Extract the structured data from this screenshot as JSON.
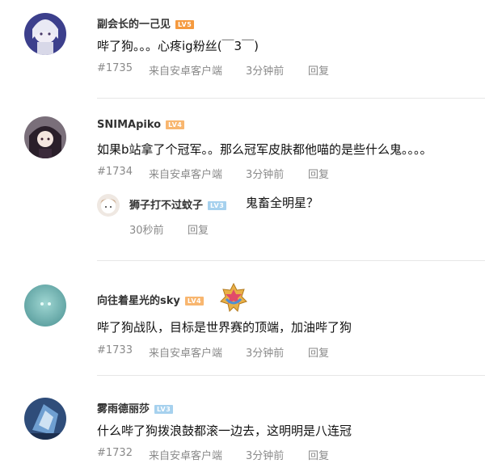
{
  "comments": [
    {
      "name": "副会长的一己见",
      "level": "LV5",
      "text": "哔了狗。。。心疼ig粉丝(￣3￣)",
      "floor": "#1735",
      "source": "来自安卓客户端",
      "time": "3分钟前",
      "reply": "回复"
    },
    {
      "name": "SNIMApiko",
      "level": "LV4",
      "text": "如果b站拿了个冠军。。那么冠军皮肤都他喵的是些什么鬼。。。。",
      "floor": "#1734",
      "source": "来自安卓客户端",
      "time": "3分钟前",
      "reply": "回复",
      "sub_reply": {
        "name": "狮子打不过蚊子",
        "level": "LV3",
        "text": "鬼畜全明星？",
        "time": "30秒前",
        "reply": "回复"
      }
    },
    {
      "name": "向往着星光的sky",
      "level": "LV4",
      "text": "哔了狗战队，目标是世界赛的顶端，加油哔了狗",
      "floor": "#1733",
      "source": "来自安卓客户端",
      "time": "3分钟前",
      "reply": "回复"
    },
    {
      "name": "雾雨德丽莎",
      "level": "LV3",
      "text": "什么哔了狗拨浪鼓都滚一边去，这明明是八连冠",
      "floor": "#1732",
      "source": "来自安卓客户端",
      "time": "3分钟前",
      "reply": "回复"
    }
  ],
  "colors": {
    "lv5": "#f59a3f",
    "lv4": "#f8b66f",
    "lv3": "#a6d1ee",
    "meta_text": "#8a8a8a",
    "divider": "#e6e6e6"
  }
}
